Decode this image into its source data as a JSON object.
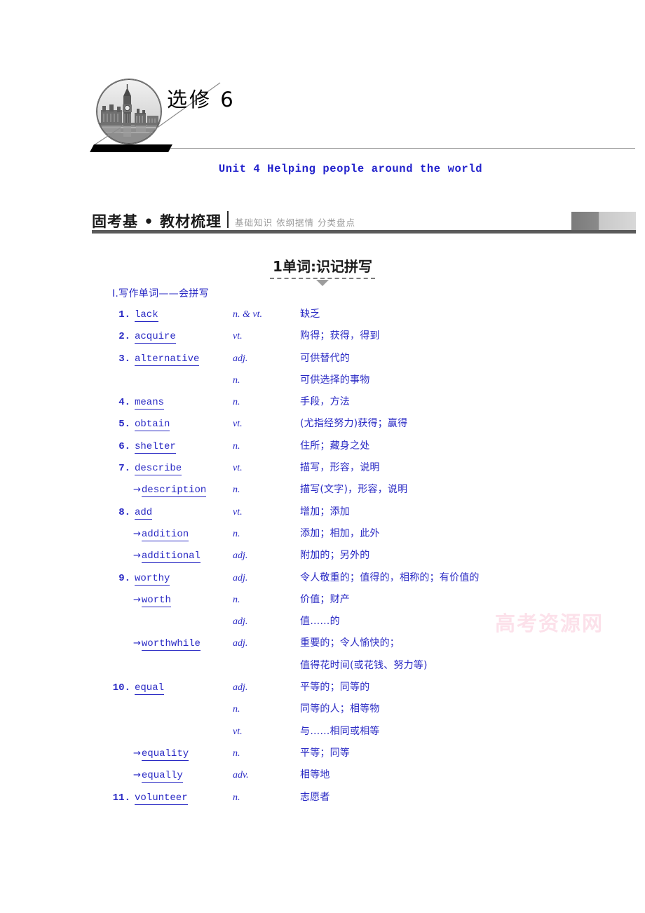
{
  "banner": {
    "book_title": "选修 6",
    "unit_title": "Unit 4  Helping people around the world",
    "circle_icon": "big-ben-photo"
  },
  "section_header": {
    "main_title": "固考基 • 教材梳理",
    "subtitle": "基础知识 依纲据情 分类盘点"
  },
  "topic": {
    "title": "1单词:识记拼写"
  },
  "vocab": {
    "group_title": "Ⅰ.写作单词——会拼写",
    "entries": [
      {
        "num": "1.",
        "word": "lack",
        "arrow": "",
        "pos": "n. & vt.",
        "meaning": "缺乏"
      },
      {
        "num": "2.",
        "word": "acquire",
        "arrow": "",
        "pos": "vt.",
        "meaning": "购得；获得，得到"
      },
      {
        "num": "3.",
        "word": "alternative",
        "arrow": "",
        "pos": "adj.",
        "meaning": "可供替代的"
      },
      {
        "num": "",
        "word": "",
        "arrow": "",
        "pos": "n.",
        "meaning": "可供选择的事物"
      },
      {
        "num": "4.",
        "word": "means",
        "arrow": "",
        "pos": "n.",
        "meaning": "手段，方法"
      },
      {
        "num": "5.",
        "word": "obtain",
        "arrow": "",
        "pos": "vt.",
        "meaning": "(尤指经努力)获得；赢得"
      },
      {
        "num": "6.",
        "word": "shelter",
        "arrow": "",
        "pos": "n.",
        "meaning": "住所；藏身之处"
      },
      {
        "num": "7.",
        "word": "describe",
        "arrow": "",
        "pos": "vt.",
        "meaning": "描写，形容，说明"
      },
      {
        "num": "",
        "word": "description",
        "arrow": "→",
        "pos": "n.",
        "meaning": "描写(文字)，形容，说明"
      },
      {
        "num": "8.",
        "word": "add",
        "arrow": "",
        "pos": "vt.",
        "meaning": "增加；添加"
      },
      {
        "num": "",
        "word": "addition",
        "arrow": "→",
        "pos": "n.",
        "meaning": "添加；相加，此外"
      },
      {
        "num": "",
        "word": "additional",
        "arrow": "→",
        "pos": "adj.",
        "meaning": "附加的；另外的"
      },
      {
        "num": "9.",
        "word": "worthy",
        "arrow": "",
        "pos": "adj.",
        "meaning": "令人敬重的；值得的，相称的；有价值的"
      },
      {
        "num": "",
        "word": "worth",
        "arrow": "→",
        "pos": "n.",
        "meaning": "价值；财产"
      },
      {
        "num": "",
        "word": "",
        "arrow": "",
        "pos": "adj.",
        "meaning": "值……的"
      },
      {
        "num": "",
        "word": "worthwhile",
        "arrow": "→",
        "pos": "adj.",
        "meaning": "重要的；令人愉快的；"
      },
      {
        "num": "",
        "word": "",
        "arrow": "",
        "pos": "",
        "meaning": "值得花时间(或花钱、努力等)"
      },
      {
        "num": "10.",
        "word": "equal",
        "arrow": "",
        "pos": "adj.",
        "meaning": "平等的；同等的"
      },
      {
        "num": "",
        "word": "",
        "arrow": "",
        "pos": "n.",
        "meaning": "同等的人；相等物"
      },
      {
        "num": "",
        "word": "",
        "arrow": "",
        "pos": "vt.",
        "meaning": "与……相同或相等"
      },
      {
        "num": "",
        "word": "equality",
        "arrow": "→",
        "pos": "n.",
        "meaning": "平等；同等"
      },
      {
        "num": "",
        "word": "equally",
        "arrow": "→",
        "pos": "adv.",
        "meaning": "相等地"
      },
      {
        "num": "11.",
        "word": "volunteer",
        "arrow": "",
        "pos": "n.",
        "meaning": "志愿者"
      }
    ]
  },
  "watermark": {
    "text": "高考资源网"
  },
  "colors": {
    "text_blue": "#2929c4",
    "header_gray": "#5a5a5a",
    "subtitle_gray": "#9b9b9b",
    "watermark_pink": "#fbd8e4"
  }
}
